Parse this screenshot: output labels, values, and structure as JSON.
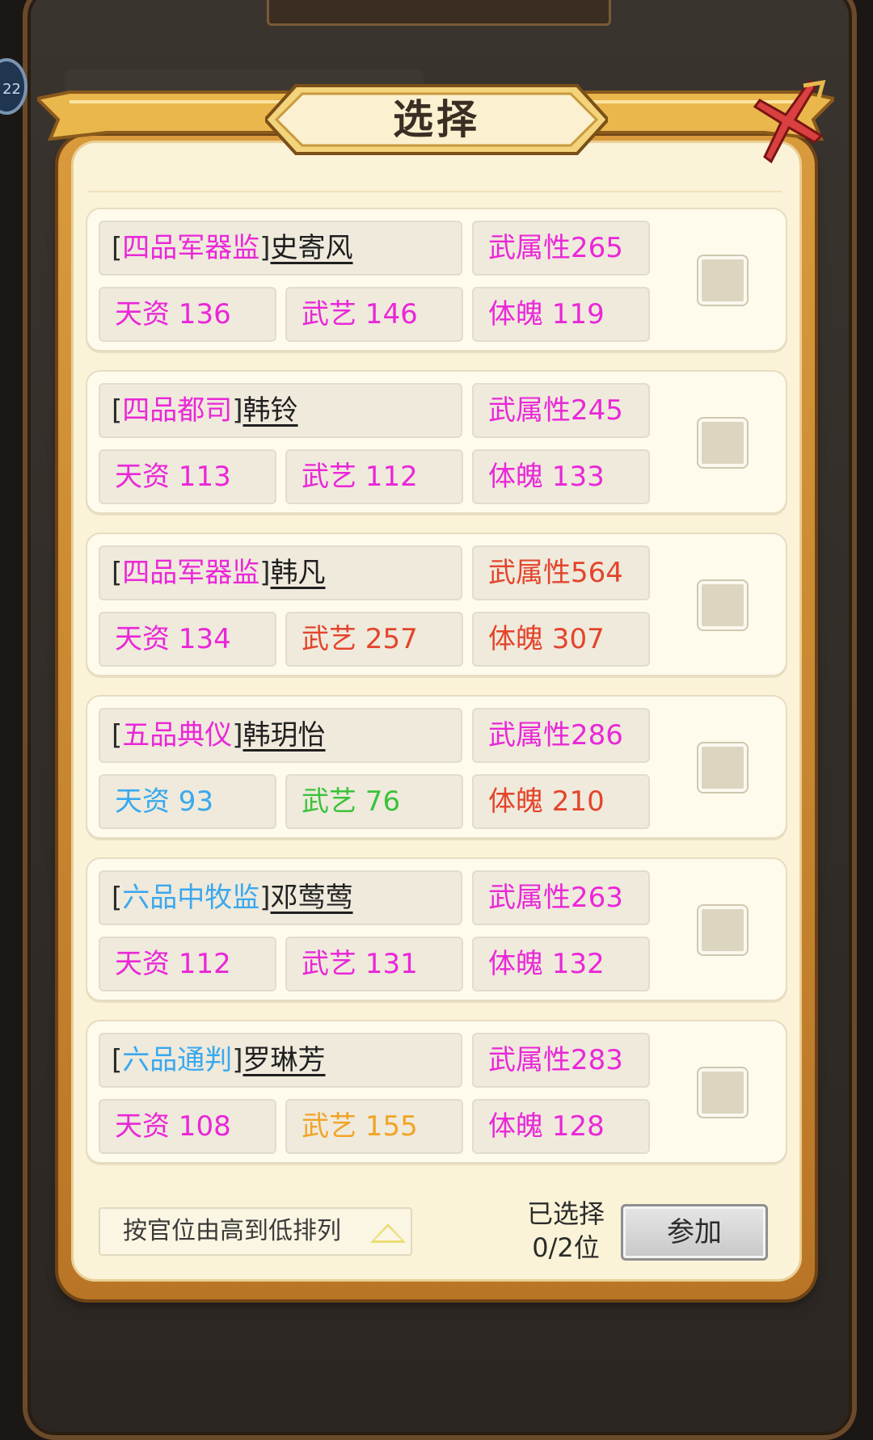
{
  "dialog": {
    "title": "选择"
  },
  "colors": {
    "magenta": "#ea27d8",
    "blue": "#3aa8ee",
    "red": "#e4442c",
    "green": "#3cc23c",
    "orange": "#f1a427",
    "panel_bg": "#fbf3d8",
    "frame_gold": "#d99a3c",
    "close_red": "#d94040"
  },
  "icons": {
    "close": "close-x-icon",
    "sort": "triangle-up-icon"
  },
  "candidates": [
    {
      "rank_open": "[",
      "rank": "四品军器监",
      "rank_close": "]",
      "name": "史寄风",
      "rank_color": "magenta",
      "wushu": "武属性265",
      "wushu_color": "magenta",
      "tianzi": "天资 136",
      "tianzi_color": "magenta",
      "wuyi": "武艺 146",
      "wuyi_color": "magenta",
      "tipo": "体魄 119",
      "tipo_color": "magenta",
      "checked": false
    },
    {
      "rank_open": "[",
      "rank": "四品都司",
      "rank_close": "]",
      "name": "韩铃",
      "rank_color": "magenta",
      "wushu": "武属性245",
      "wushu_color": "magenta",
      "tianzi": "天资 113",
      "tianzi_color": "magenta",
      "wuyi": "武艺 112",
      "wuyi_color": "magenta",
      "tipo": "体魄 133",
      "tipo_color": "magenta",
      "checked": false
    },
    {
      "rank_open": "[",
      "rank": "四品军器监",
      "rank_close": "]",
      "name": "韩凡",
      "rank_color": "magenta",
      "wushu": "武属性564",
      "wushu_color": "red",
      "tianzi": "天资 134",
      "tianzi_color": "magenta",
      "wuyi": "武艺 257",
      "wuyi_color": "red",
      "tipo": "体魄 307",
      "tipo_color": "red",
      "checked": false
    },
    {
      "rank_open": "[",
      "rank": "五品典仪",
      "rank_close": "]",
      "name": "韩玥怡",
      "rank_color": "magenta",
      "wushu": "武属性286",
      "wushu_color": "magenta",
      "tianzi": "天资 93",
      "tianzi_color": "blue",
      "wuyi": "武艺 76",
      "wuyi_color": "green",
      "tipo": "体魄 210",
      "tipo_color": "red",
      "checked": false
    },
    {
      "rank_open": "[",
      "rank": "六品中牧监",
      "rank_close": "]",
      "name": "邓莺莺",
      "rank_color": "blue",
      "wushu": "武属性263",
      "wushu_color": "magenta",
      "tianzi": "天资 112",
      "tianzi_color": "magenta",
      "wuyi": "武艺 131",
      "wuyi_color": "magenta",
      "tipo": "体魄 132",
      "tipo_color": "magenta",
      "checked": false
    },
    {
      "rank_open": "[",
      "rank": "六品通判",
      "rank_close": "]",
      "name": "罗琳芳",
      "rank_color": "blue",
      "wushu": "武属性283",
      "wushu_color": "magenta",
      "tianzi": "天资 108",
      "tianzi_color": "magenta",
      "wuyi": "武艺 155",
      "wuyi_color": "orange",
      "tipo": "体魄 128",
      "tipo_color": "magenta",
      "checked": false
    }
  ],
  "footer": {
    "sort_label": "按官位由高到低排列",
    "selected_label": "已选择",
    "selected_count": "0/2位",
    "join_label": "参加"
  },
  "background": {
    "left_badge_text": "22"
  }
}
